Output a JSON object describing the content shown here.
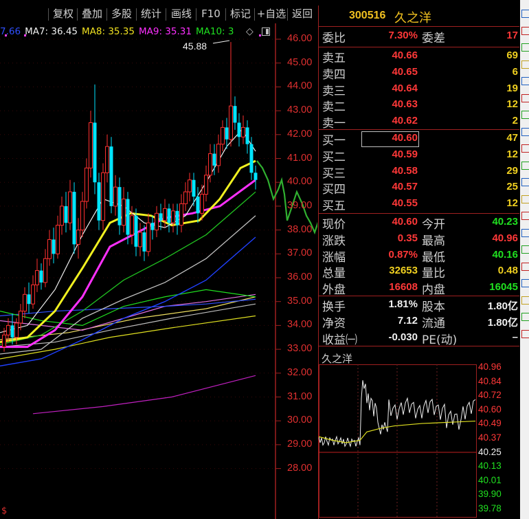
{
  "toolbar": {
    "buttons": [
      "复权",
      "叠加",
      "多股",
      "统计",
      "画线",
      "F10",
      "标记",
      "+自选",
      "返回"
    ]
  },
  "ma_legend": [
    {
      "text": "7.66",
      "color": "#3050ff"
    },
    {
      "text": "MA7: 36.45",
      "color": "#f0f0f0"
    },
    {
      "text": "MA8: 35.35",
      "color": "#f0e020"
    },
    {
      "text": "MA9: 35.31",
      "color": "#ff30ff"
    },
    {
      "text": "MA10: 3",
      "color": "#20e020"
    }
  ],
  "legend_symbol": "◇",
  "price_axis": [
    "46.00",
    "45.00",
    "44.00",
    "43.00",
    "42.00",
    "41.00",
    "40.00",
    "39.00",
    "38.00",
    "37.00",
    "36.00",
    "35.00",
    "34.00",
    "33.00",
    "32.00",
    "31.00",
    "30.00",
    "29.00",
    "28.00"
  ],
  "high_annotation": "45.88",
  "bottom_mark": "$",
  "quote": {
    "code": "300516",
    "name": "久之洋",
    "weibi": {
      "label": "委比",
      "value": "7.30%",
      "label2": "委差",
      "value2": "17"
    },
    "sell": [
      {
        "label": "卖五",
        "price": "40.66",
        "vol": "69"
      },
      {
        "label": "卖四",
        "price": "40.65",
        "vol": "6"
      },
      {
        "label": "卖三",
        "price": "40.64",
        "vol": "19"
      },
      {
        "label": "卖二",
        "price": "40.63",
        "vol": "12"
      },
      {
        "label": "卖一",
        "price": "40.62",
        "vol": "2"
      }
    ],
    "buy": [
      {
        "label": "买一",
        "price": "40.60",
        "vol": "47"
      },
      {
        "label": "买二",
        "price": "40.59",
        "vol": "12"
      },
      {
        "label": "买三",
        "price": "40.58",
        "vol": "29"
      },
      {
        "label": "买四",
        "price": "40.57",
        "vol": "25"
      },
      {
        "label": "买五",
        "price": "40.55",
        "vol": "12"
      }
    ],
    "stats": [
      {
        "l1": "现价",
        "v1": "40.60",
        "c1": "red",
        "l2": "今开",
        "v2": "40.23",
        "c2": "grn"
      },
      {
        "l1": "涨跌",
        "v1": "0.35",
        "c1": "red",
        "l2": "最高",
        "v2": "40.96",
        "c2": "red"
      },
      {
        "l1": "涨幅",
        "v1": "0.87%",
        "c1": "red",
        "l2": "最低",
        "v2": "40.16",
        "c2": "grn"
      },
      {
        "l1": "总量",
        "v1": "32653",
        "c1": "yel",
        "l2": "量比",
        "v2": "0.48",
        "c2": "yel"
      },
      {
        "l1": "外盘",
        "v1": "16608",
        "c1": "red",
        "l2": "内盘",
        "v2": "16045",
        "c2": "grn"
      }
    ],
    "fundamentals": [
      {
        "l1": "换手",
        "v1": "1.81%",
        "l2": "股本",
        "v2": "1.80亿"
      },
      {
        "l1": "净资",
        "v1": "7.12",
        "l2": "流通",
        "v2": "1.80亿"
      },
      {
        "l1": "收益㈠",
        "v1": "-0.030",
        "l2": "PE(动)",
        "v2": "–"
      }
    ]
  },
  "mini_chart": {
    "title": "久之洋",
    "ticks": [
      {
        "v": "40.96",
        "c": "#ff3838"
      },
      {
        "v": "40.84",
        "c": "#ff3838"
      },
      {
        "v": "40.72",
        "c": "#ff3838"
      },
      {
        "v": "40.60",
        "c": "#ff3838"
      },
      {
        "v": "40.49",
        "c": "#ff3838"
      },
      {
        "v": "40.37",
        "c": "#ff3838"
      },
      {
        "v": "40.25",
        "c": "#f0f0f0"
      },
      {
        "v": "40.13",
        "c": "#20e020"
      },
      {
        "v": "40.01",
        "c": "#20e020"
      },
      {
        "v": "39.90",
        "c": "#20e020"
      },
      {
        "v": "39.78",
        "c": "#20e020"
      }
    ]
  },
  "colors": {
    "up": "#ff3030",
    "down": "#00e5ff",
    "border": "#a02020",
    "accent": "#f0c020"
  }
}
